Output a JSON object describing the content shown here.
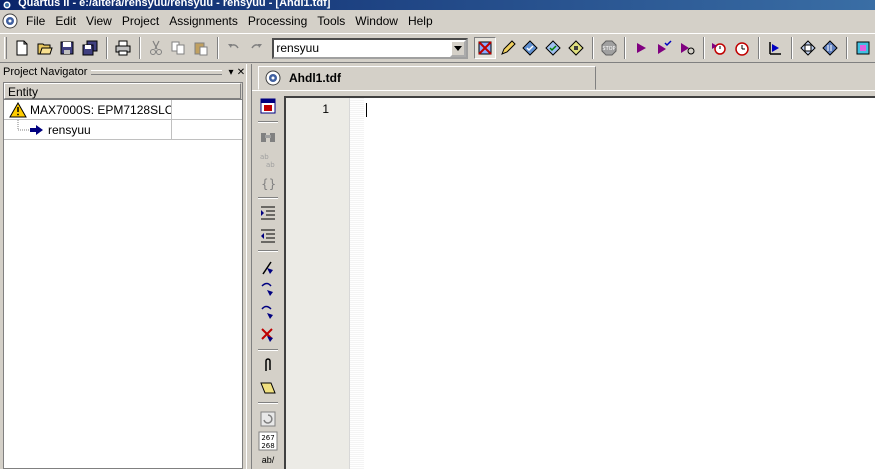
{
  "window": {
    "title": "Quartus II - e:/altera/rensyuu/rensyuu - rensyuu - [Ahdl1.tdf]"
  },
  "menu": {
    "items": [
      {
        "label": "File"
      },
      {
        "label": "Edit"
      },
      {
        "label": "View"
      },
      {
        "label": "Project"
      },
      {
        "label": "Assignments"
      },
      {
        "label": "Processing"
      },
      {
        "label": "Tools"
      },
      {
        "label": "Window"
      },
      {
        "label": "Help"
      }
    ]
  },
  "toolbar": {
    "project_combo_value": "rensyuu"
  },
  "navigator": {
    "title": "Project Navigator",
    "column_header": "Entity",
    "rows": [
      {
        "label": "MAX7000S: EPM7128SLC..."
      },
      {
        "label": "rensyuu"
      }
    ]
  },
  "editor": {
    "tab_label": "Ahdl1.tdf",
    "line_numbers": [
      "1"
    ],
    "counter_icon_top": "267",
    "counter_icon_bottom": "268",
    "abc_icon_label": "ab/"
  },
  "colors": {
    "titlebar_start": "#0a246a",
    "titlebar_end": "#3a6ea5",
    "face": "#d4d0c8",
    "warning": "#ffcc00",
    "accent_blue": "#0000c0",
    "accent_purple": "#800080",
    "stop_red": "#c00000"
  }
}
